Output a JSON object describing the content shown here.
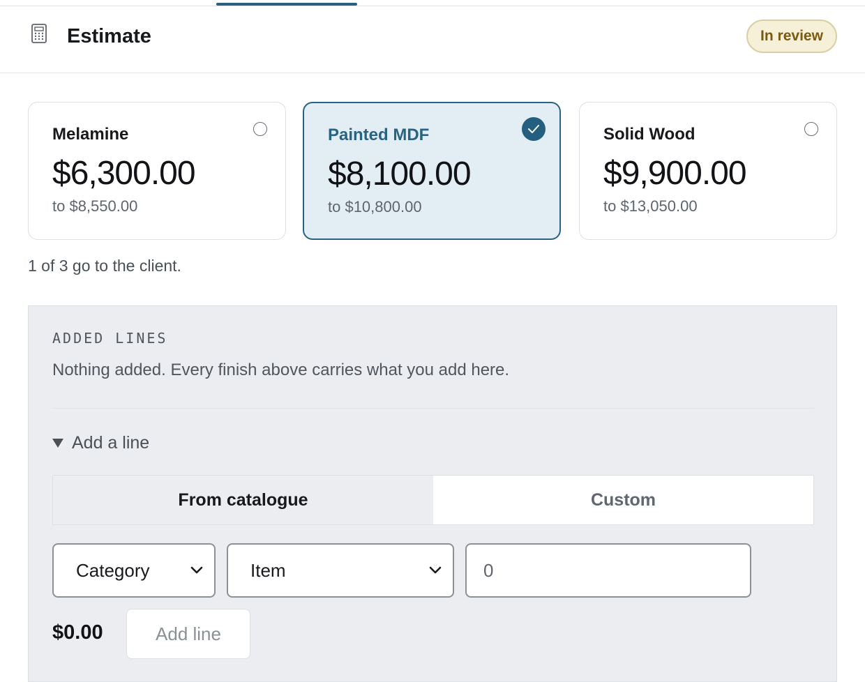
{
  "header": {
    "title": "Estimate",
    "status_badge": "In review",
    "icon": "calculator-icon"
  },
  "options": [
    {
      "name": "Melamine",
      "price": "$6,300.00",
      "range": "to $8,550.00",
      "selected": false
    },
    {
      "name": "Painted MDF",
      "price": "$8,100.00",
      "range": "to $10,800.00",
      "selected": true
    },
    {
      "name": "Solid Wood",
      "price": "$9,900.00",
      "range": "to $13,050.00",
      "selected": false
    }
  ],
  "selection_note": "1 of 3 go to the client.",
  "added_lines": {
    "label": "ADDED LINES",
    "empty_message": "Nothing added. Every finish above carries what you add here.",
    "add_toggle": "Add a line",
    "tabs": [
      {
        "label": "From catalogue",
        "active": true
      },
      {
        "label": "Custom",
        "active": false
      }
    ],
    "category_select": "Category",
    "item_select": "Item",
    "quantity_value": "0",
    "line_total": "$0.00",
    "add_button": "Add line"
  },
  "colors": {
    "accent": "#2a6282",
    "selected_bg": "#e3eef4",
    "badge_bg": "#f7f0d8",
    "badge_text": "#7a5a10",
    "panel_bg": "#ebedf0"
  }
}
